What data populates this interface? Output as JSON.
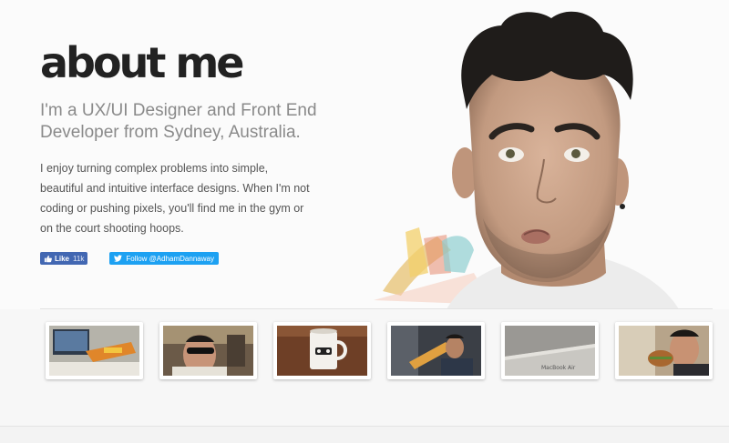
{
  "page": {
    "title": "about me",
    "subtitle": "I'm a UX/UI Designer and Front End Developer from Sydney, Australia.",
    "bio": "I enjoy turning complex problems into simple, beautiful and intuitive interface designs. When I'm not coding or pushing pixels, you'll find me in the gym or on the court shooting hoops."
  },
  "social": {
    "fb_like_label": "Like",
    "fb_like_count": "11k",
    "twitter_label": "Follow @AdhamDannaway"
  },
  "thumbnails": [
    {
      "alt": "desk with nerf gun"
    },
    {
      "alt": "man in sunglasses"
    },
    {
      "alt": "stormtrooper mug"
    },
    {
      "alt": "man with nerf gun"
    },
    {
      "alt": "macbook air"
    },
    {
      "alt": "man eating burger"
    }
  ],
  "colors": {
    "facebook": "#4267b2",
    "twitter": "#1da1f2",
    "title": "#222222"
  }
}
